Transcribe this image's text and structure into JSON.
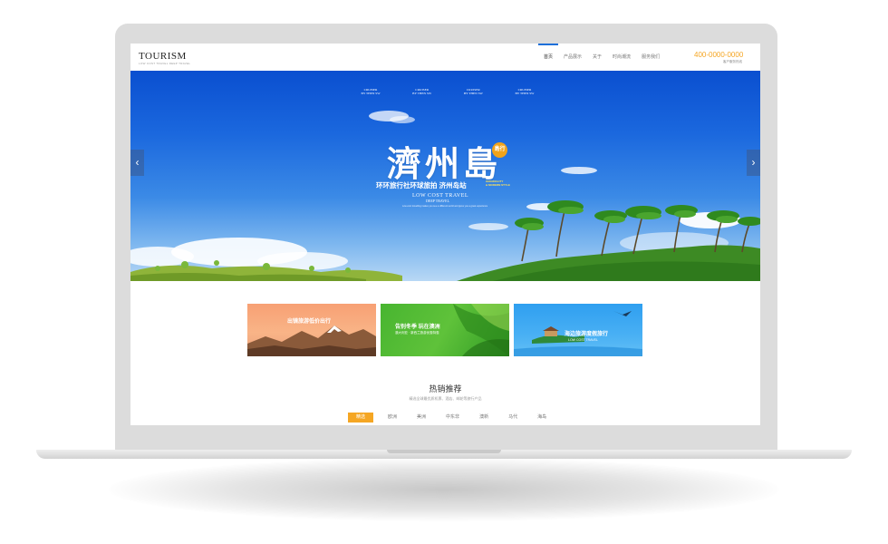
{
  "site": {
    "logo": "TOURISM",
    "logo_sub": "LOW COST TRAVEL DEEP TRAVEL",
    "phone": "400-0000-0000",
    "phone_label": "客户服务热线"
  },
  "nav": {
    "items": [
      {
        "label": "首页",
        "active": true
      },
      {
        "label": "产品展示",
        "active": false
      },
      {
        "label": "关于",
        "active": false
      },
      {
        "label": "时尚潮流",
        "active": false
      },
      {
        "label": "服务我们",
        "active": false
      }
    ]
  },
  "hero": {
    "decor": [
      "CRUISER",
      "CRUISER",
      "CRUISER",
      "CRUISER"
    ],
    "decor_sub": [
      "BY THEN SW",
      "BY THEN SW",
      "BY THEN SW",
      "BY THEN SW"
    ],
    "title": "濟州島",
    "seal": "島行",
    "subtitle": "环环旅行社环球旅拍 济州岛站",
    "badge_line1": "ORIGINALITY",
    "badge_line2": "& MODERN STYLE",
    "en_line1": "LOW COST TRAVEL",
    "en_line2": "DEEP TRAVEL",
    "fine_print": "Low-cost travelling makes you see a different world and gives you a great experience",
    "prev_arrow": "‹",
    "next_arrow": "›"
  },
  "banners": [
    {
      "title": "出镜旅游低价出行",
      "subtitle": ""
    },
    {
      "title": "告别冬季 玩在澳洲",
      "subtitle": "澳大利亚 · 新西兰旅游优惠特惠"
    },
    {
      "title": "海边旅游度假旅行",
      "subtitle": "LOW COST TRAVEL"
    }
  ],
  "products": {
    "title": "热销推荐",
    "subtitle": "精选全球最优质机票、酒店、邮轮等旅行产品",
    "tabs": [
      {
        "label": "精选",
        "active": true
      },
      {
        "label": "欧洲",
        "active": false
      },
      {
        "label": "美洲",
        "active": false
      },
      {
        "label": "中东非",
        "active": false
      },
      {
        "label": "澳新",
        "active": false
      },
      {
        "label": "马代",
        "active": false
      },
      {
        "label": "海岛",
        "active": false
      }
    ]
  }
}
